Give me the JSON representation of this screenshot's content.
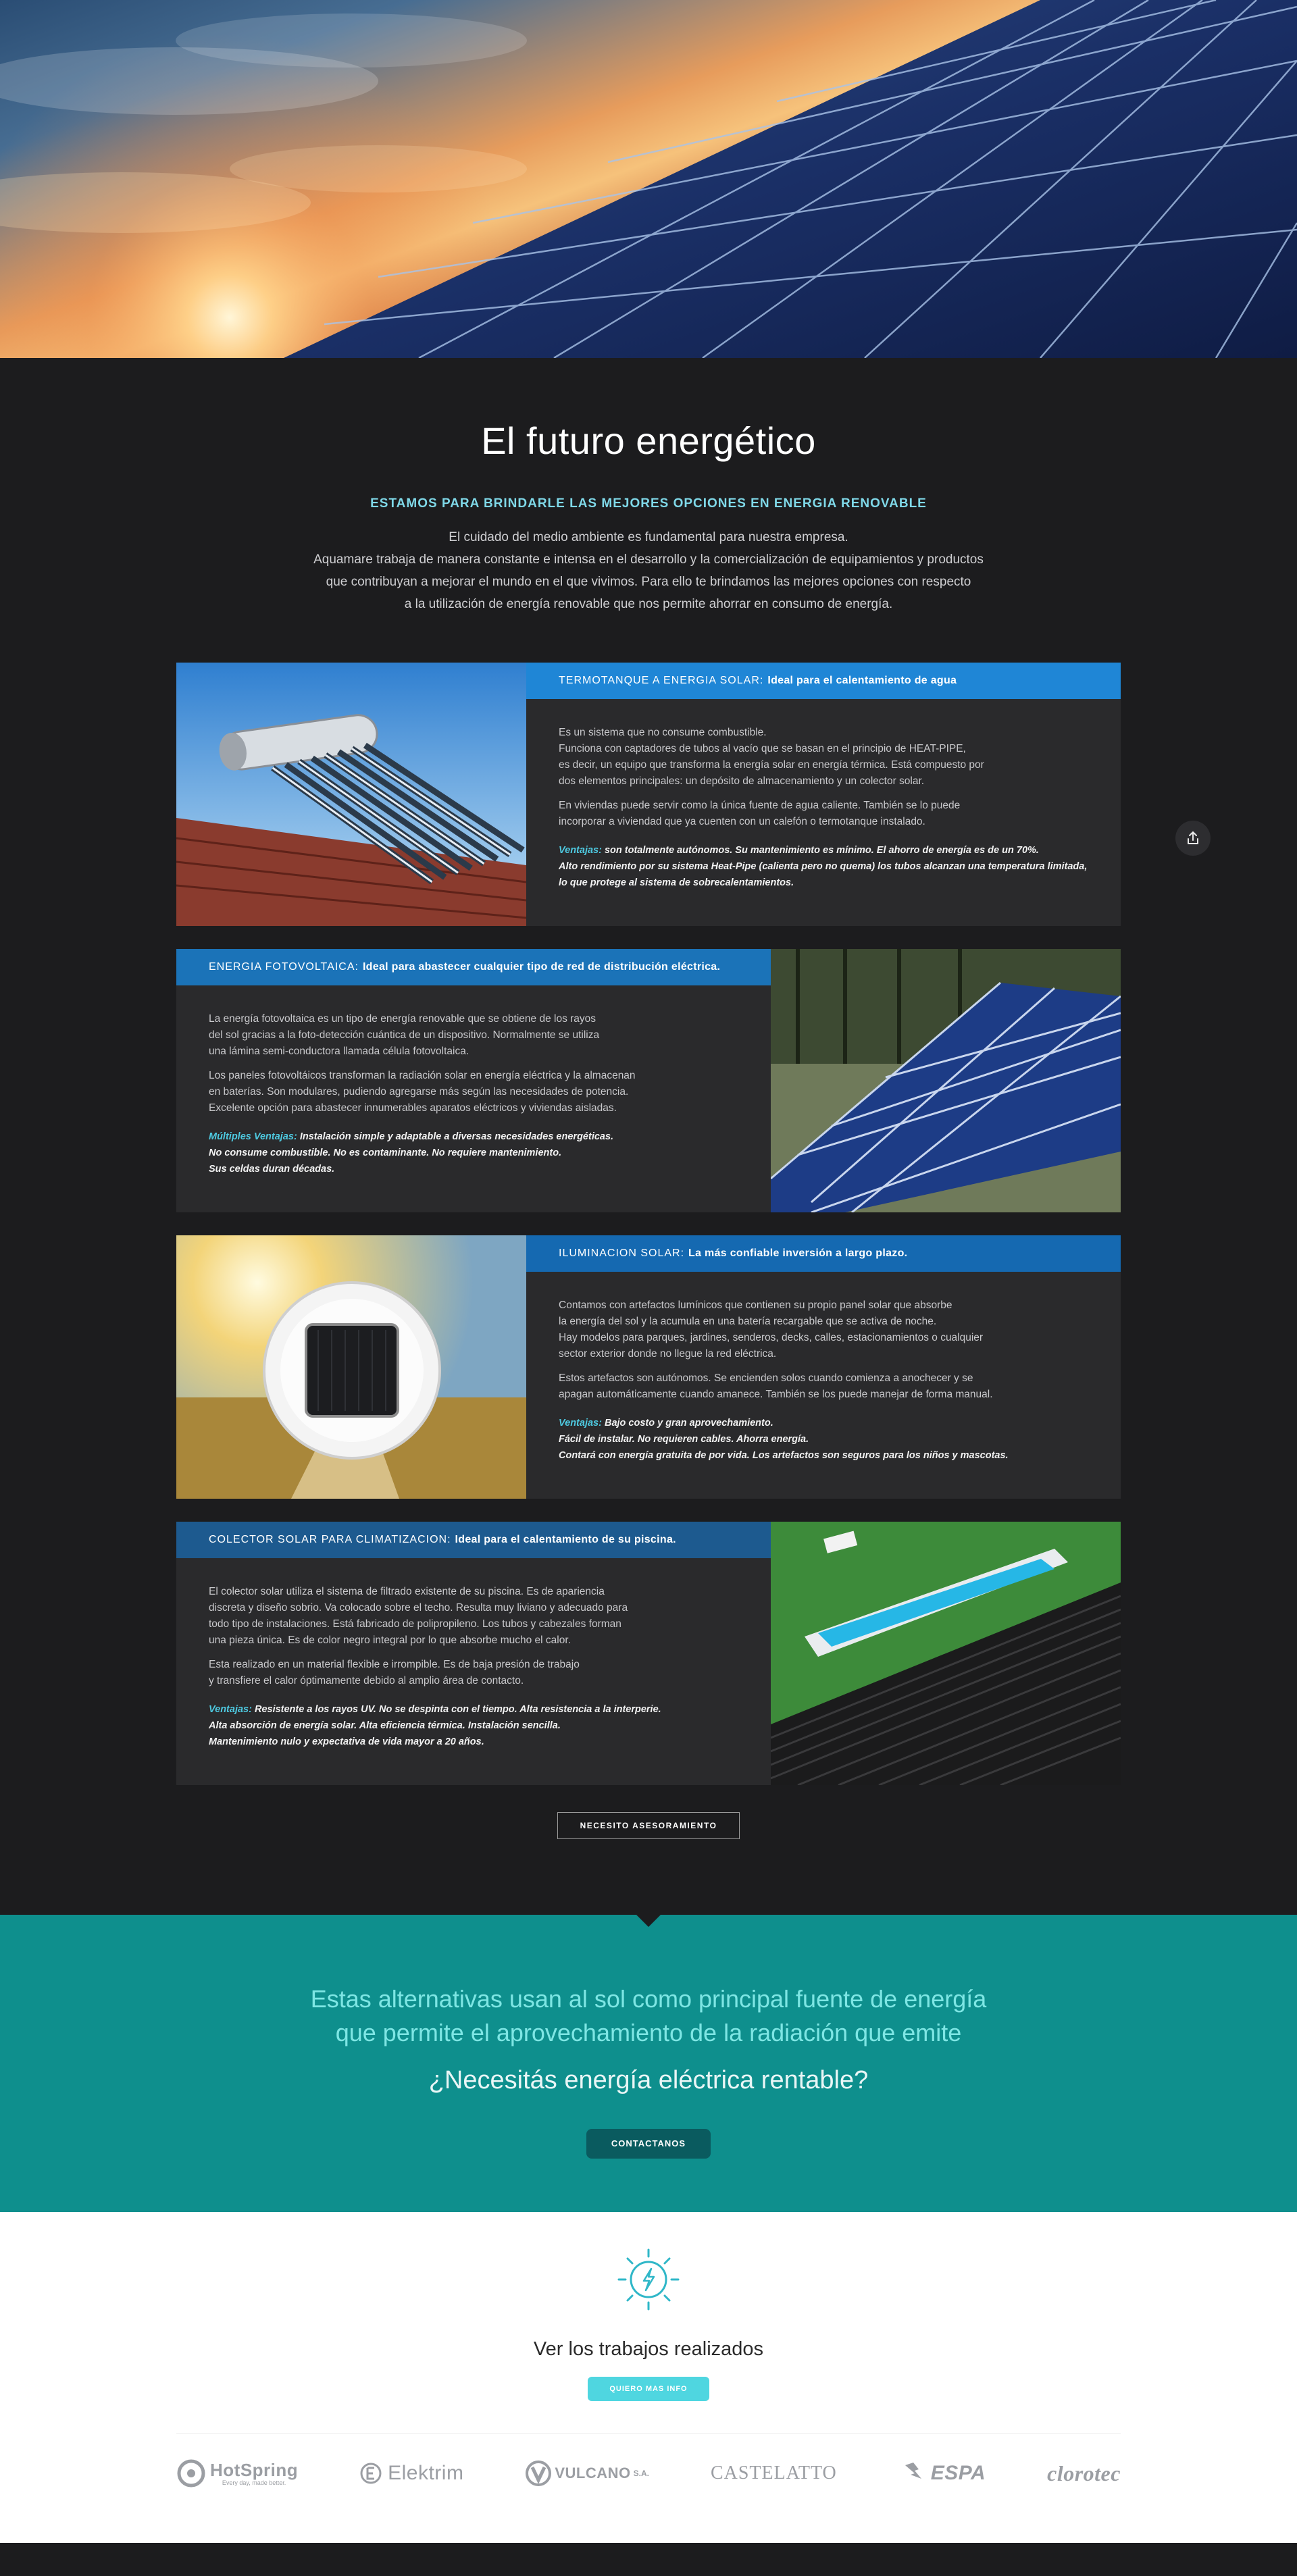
{
  "intro": {
    "title": "El futuro energético",
    "subtitle": "ESTAMOS PARA BRINDARLE LAS MEJORES OPCIONES EN ENERGIA RENOVABLE",
    "lines": [
      "El cuidado del medio ambiente es fundamental para nuestra empresa.",
      "Aquamare trabaja de manera constante e intensa en el desarrollo y la comercialización de equipamientos y productos",
      "que contribuyan a mejorar el mundo en el que vivimos. Para ello te brindamos las mejores opciones con respecto",
      "a la utilización de energía renovable que nos permite ahorrar en consumo de energía."
    ]
  },
  "services": [
    {
      "kicker": "TERMOTANQUE A ENERGIA SOLAR:",
      "headline": "Ideal para el calentamiento de agua",
      "paragraphs": [
        [
          "Es un sistema que no consume combustible.",
          "Funciona con captadores de tubos al vacío que se basan en el principio de HEAT-PIPE,",
          "es decir, un equipo que transforma la energía solar en energía térmica. Está compuesto por",
          "dos elementos principales: un depósito de almacenamiento y un colector solar."
        ],
        [
          "En viviendas puede servir como la única fuente de agua caliente. También se lo puede",
          "incorporar a viviendad que ya cuenten con un calefón o termotanque instalado."
        ]
      ],
      "adv_key": "Ventajas:",
      "adv_lines": [
        "son totalmente autónomos. Su mantenimiento es mínimo. El ahorro de energía es de un 70%.",
        "Alto rendimiento por su sistema Heat-Pipe (calienta pero no quema) los tubos alcanzan una temperatura limitada,",
        "lo que protege al sistema de sobrecalentamientos."
      ]
    },
    {
      "kicker": "ENERGIA FOTOVOLTAICA:",
      "headline": "Ideal para abastecer cualquier tipo de red de distribución eléctrica.",
      "paragraphs": [
        [
          "La energía fotovoltaica es un tipo de energía renovable que se obtiene de los rayos",
          "del sol gracias a la foto-detección cuántica de un dispositivo. Normalmente se utiliza",
          "una lámina semi-conductora llamada célula fotovoltaica."
        ],
        [
          "Los paneles fotovoltáicos transforman la radiación solar en energía eléctrica y la almacenan",
          "en baterías. Son modulares, pudiendo agregarse más según las necesidades de potencia.",
          "Excelente opción para abastecer innumerables aparatos eléctricos y viviendas aisladas."
        ]
      ],
      "adv_key": "Múltiples Ventajas:",
      "adv_lines": [
        "Instalación simple y adaptable a diversas necesidades energéticas.",
        "No consume combustible. No es contaminante. No requiere mantenimiento.",
        "Sus celdas duran décadas."
      ]
    },
    {
      "kicker": "ILUMINACION SOLAR:",
      "headline": "La más confiable inversión a largo plazo.",
      "paragraphs": [
        [
          "Contamos con artefactos lumínicos que contienen su propio panel solar que absorbe",
          "la energía del sol y la acumula en una batería recargable que se activa de noche.",
          "Hay modelos para parques, jardines, senderos, decks, calles, estacionamientos o cualquier",
          "sector exterior donde no llegue la red eléctrica."
        ],
        [
          "Estos artefactos son autónomos. Se encienden solos cuando comienza a anochecer y se",
          "apagan automáticamente cuando amanece. También se los puede manejar de forma manual."
        ]
      ],
      "adv_key": "Ventajas:",
      "adv_lines": [
        "Bajo costo y gran aprovechamiento.",
        "Fácil de instalar. No requieren cables. Ahorra energía.",
        "Contará con energía gratuita de por vida. Los artefactos son seguros para los niños y mascotas."
      ]
    },
    {
      "kicker": "COLECTOR SOLAR PARA CLIMATIZACION:",
      "headline": "Ideal para el calentamiento de su piscina.",
      "paragraphs": [
        [
          "El colector solar utiliza el sistema de filtrado existente de su piscina. Es de apariencia",
          "discreta y diseño sobrio. Va colocado sobre el techo. Resulta muy liviano y adecuado para",
          "todo tipo de instalaciones. Está fabricado de polipropileno. Los tubos y cabezales forman",
          "una pieza única. Es de color negro integral por lo que absorbe mucho el calor."
        ],
        [
          "Esta realizado en un material flexible e irrompible. Es de baja presión de trabajo",
          "y transfiere el calor óptimamente debido al amplio área de contacto."
        ]
      ],
      "adv_key": "Ventajas:",
      "adv_lines": [
        "Resistente a los rayos UV. No se despinta con el tiempo. Alta resistencia a la interperie.",
        "Alta absorción de energía solar. Alta eficiencia térmica. Instalación sencilla.",
        "Mantenimiento nulo y expectativa de vida mayor a 20 años."
      ]
    }
  ],
  "cta": {
    "advice_button": "NECESITO ASESORAMIENTO"
  },
  "teal": {
    "line1": "Estas alternativas usan al sol como principal fuente de energía",
    "line2": "que permite el aprovechamiento de la radiación que emite",
    "question": "¿Necesitás energía eléctrica rentable?",
    "contact_button": "CONTACTANOS"
  },
  "works": {
    "title": "Ver los trabajos realizados",
    "button": "QUIERO MAS INFO"
  },
  "brands": [
    "HotSpring",
    "Elektrim",
    "VULCANO",
    "CASTELATTO",
    "ESPA",
    "clorotec"
  ],
  "brand_extras": {
    "hotspring_tag": "Every day, made better.",
    "vulcano_suffix": "S.A."
  },
  "colors": {
    "accent": "#1f86d6",
    "teal": "#0e8f8d",
    "cyan": "#4fd6e0",
    "dark": "#1c1c1e"
  },
  "icons": {
    "share": "share-icon",
    "sun": "sun-bolt-icon"
  }
}
